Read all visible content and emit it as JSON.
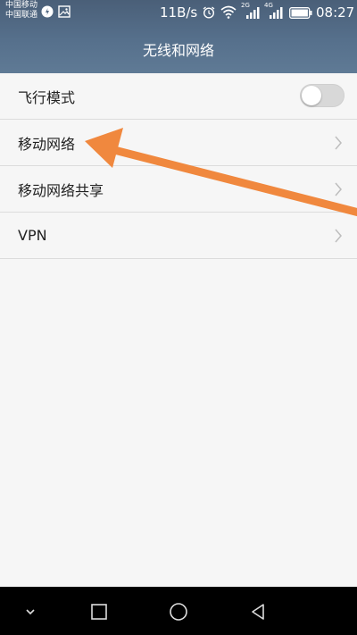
{
  "status_bar": {
    "carrier1": "中国移动",
    "carrier2": "中国联通",
    "speed": "11B/s",
    "time": "08:27",
    "net1": "2G",
    "net2": "4G",
    "icons": [
      "notification-icon",
      "image-icon",
      "alarm-icon",
      "wifi-icon",
      "signal-icon",
      "battery-icon"
    ]
  },
  "header": {
    "title": "无线和网络"
  },
  "settings": {
    "items": [
      {
        "label": "飞行模式",
        "control": "toggle",
        "value": "off"
      },
      {
        "label": "移动网络",
        "control": "chevron"
      },
      {
        "label": "移动网络共享",
        "control": "chevron"
      },
      {
        "label": "VPN",
        "control": "chevron"
      }
    ]
  },
  "annotation": {
    "color": "#f0883e",
    "target": "移动网络"
  },
  "nav_bar": {
    "buttons": [
      "collapse-icon",
      "recent-apps-icon",
      "home-icon",
      "back-icon"
    ]
  }
}
